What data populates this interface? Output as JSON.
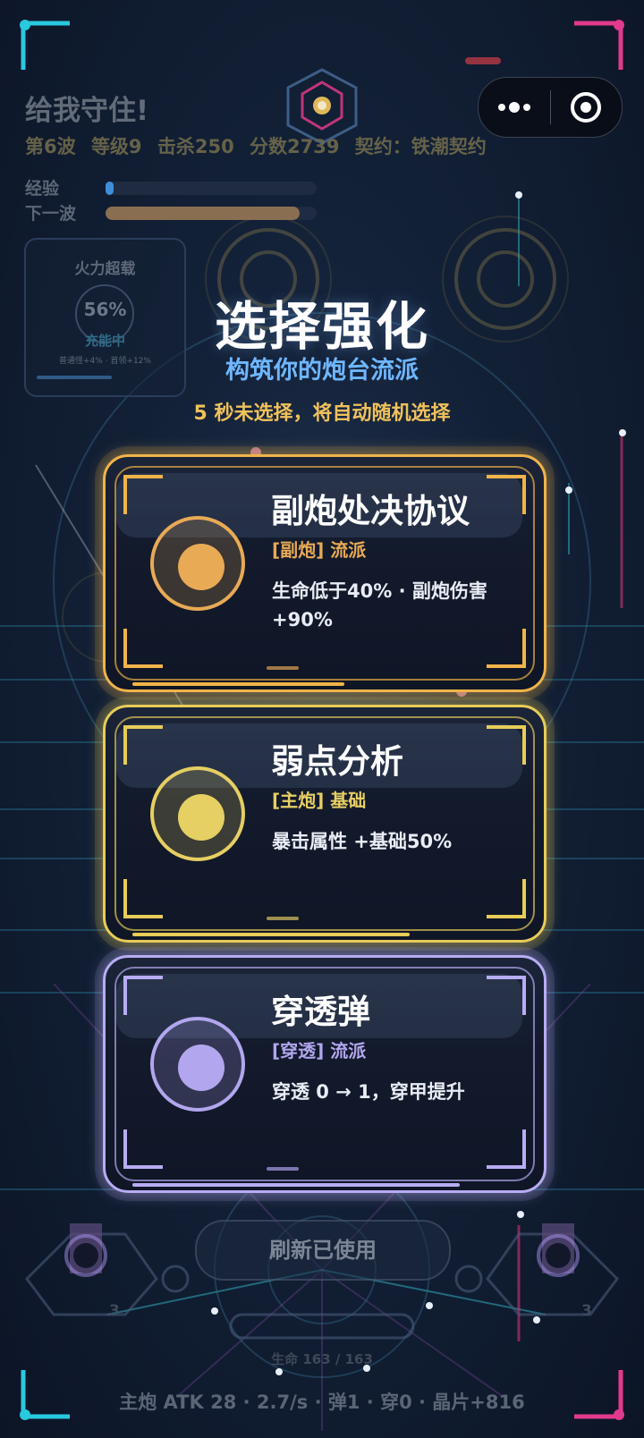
{
  "hud": {
    "title": "给我守住!",
    "wave": "第6波",
    "level": "等级9",
    "kills": "击杀250",
    "score": "分数2739",
    "contract": "契约：铁潮契约",
    "exp_label": "经验",
    "exp_fraction": 0.04,
    "next_wave_label": "下一波",
    "next_wave_fraction": 0.92
  },
  "fire_panel": {
    "title": "火力超载",
    "percent": "56%",
    "status": "充能中",
    "hint": "普通怪+4% · 首领+12%"
  },
  "capsule": {
    "more_icon": "more-dots-icon",
    "close_icon": "target-circle-icon"
  },
  "overlay": {
    "title": "选择强化",
    "subtitle": "构筑你的炮台流派",
    "timer_text": "5 秒未选择，将自动随机选择"
  },
  "cards": [
    {
      "name": "副炮处决协议",
      "tag": "[副炮] 流派",
      "desc": "生命低于40% · 副炮伤害 +90%",
      "accent": "#e8aa55",
      "frame": "#f0b44a",
      "progress": 0.55
    },
    {
      "name": "弱点分析",
      "tag": "[主炮] 基础",
      "desc": "暴击属性 +基础50%",
      "accent": "#e6cf63",
      "frame": "#e8cc58",
      "progress": 0.72
    },
    {
      "name": "穿透弹",
      "tag": "[穿透] 流派",
      "desc": "穿透 0 → 1，穿甲提升",
      "accent": "#b2a6ee",
      "frame": "#b8acf4",
      "progress": 0.85
    }
  ],
  "refresh": {
    "label": "刷新已使用"
  },
  "hp_text": "生命 163 / 163",
  "bottom_stats": "主炮 ATK 28 · 2.7/s · 弹1 · 穿0 · 晶片+816",
  "turret_levels": [
    "3",
    "3"
  ]
}
